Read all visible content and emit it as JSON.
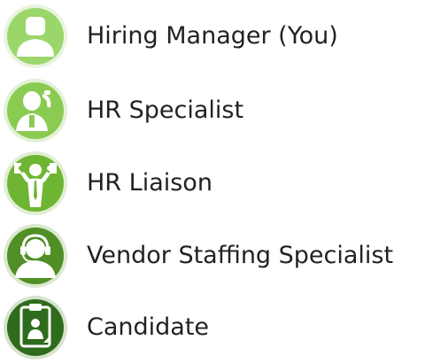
{
  "roles": [
    {
      "label": "Hiring Manager (You)",
      "icon": "hiring-manager-icon",
      "color": "#9bd66a"
    },
    {
      "label": "HR Specialist",
      "icon": "hr-specialist-icon",
      "color": "#8ccb52"
    },
    {
      "label": "HR Liaison",
      "icon": "hr-liaison-icon",
      "color": "#6fb534"
    },
    {
      "label": "Vendor Staffing Specialist",
      "icon": "vendor-staffing-specialist-icon",
      "color": "#4f8f25"
    },
    {
      "label": "Candidate",
      "icon": "candidate-icon",
      "color": "#2f6b1c"
    }
  ]
}
